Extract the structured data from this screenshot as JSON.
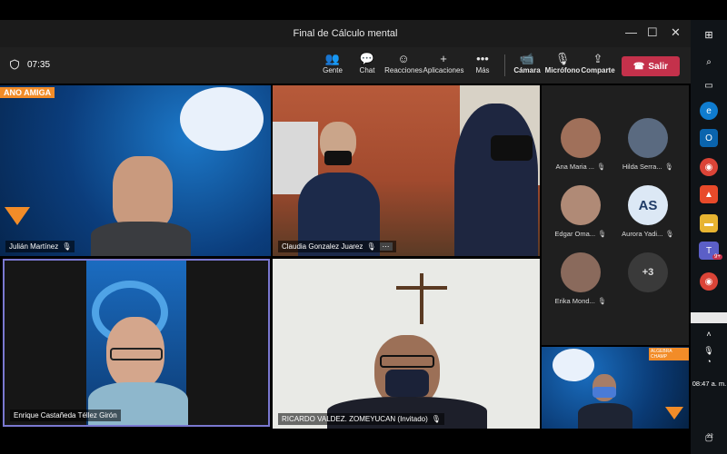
{
  "window": {
    "title": "Final de Cálculo mental",
    "minimize": "—",
    "maximize": "☐",
    "close": "✕"
  },
  "toolbar": {
    "timer": "07:35",
    "people": "Gente",
    "chat": "Chat",
    "reactions": "Reacciones",
    "apps": "Aplicaciones",
    "more": "Más",
    "camera": "Cámara",
    "mic": "Micrófono",
    "share": "Comparte",
    "leave": "Salir"
  },
  "tiles": {
    "t1": {
      "name": "Julián Martínez",
      "banner": "ANO AMIGA"
    },
    "t2": {
      "name": "Claudia Gonzalez Juarez"
    },
    "t3": {
      "name": "Enrique Castañeda Téllez Girón"
    },
    "t4": {
      "name": "RICARDO VALDEZ. ZOMEYUCAN (Invitado)"
    }
  },
  "participants": [
    {
      "name": "Ana Maria ...",
      "initials": ""
    },
    {
      "name": "Hilda Serra...",
      "initials": ""
    },
    {
      "name": "Edgar Oma...",
      "initials": ""
    },
    {
      "name": "Aurora Yadi...",
      "initials": "AS"
    },
    {
      "name": "Erika Mond...",
      "initials": ""
    }
  ],
  "more_participants": "+3",
  "self_view": {
    "banner": "ALGEBRA CHAMP"
  },
  "taskbar": {
    "clock": "08:47 a. m.",
    "notification_count": "22",
    "teams_badge": "9+"
  },
  "colors": {
    "leave": "#c4314b",
    "active_border": "#7a78d0",
    "toolbar_bg": "#202020"
  }
}
